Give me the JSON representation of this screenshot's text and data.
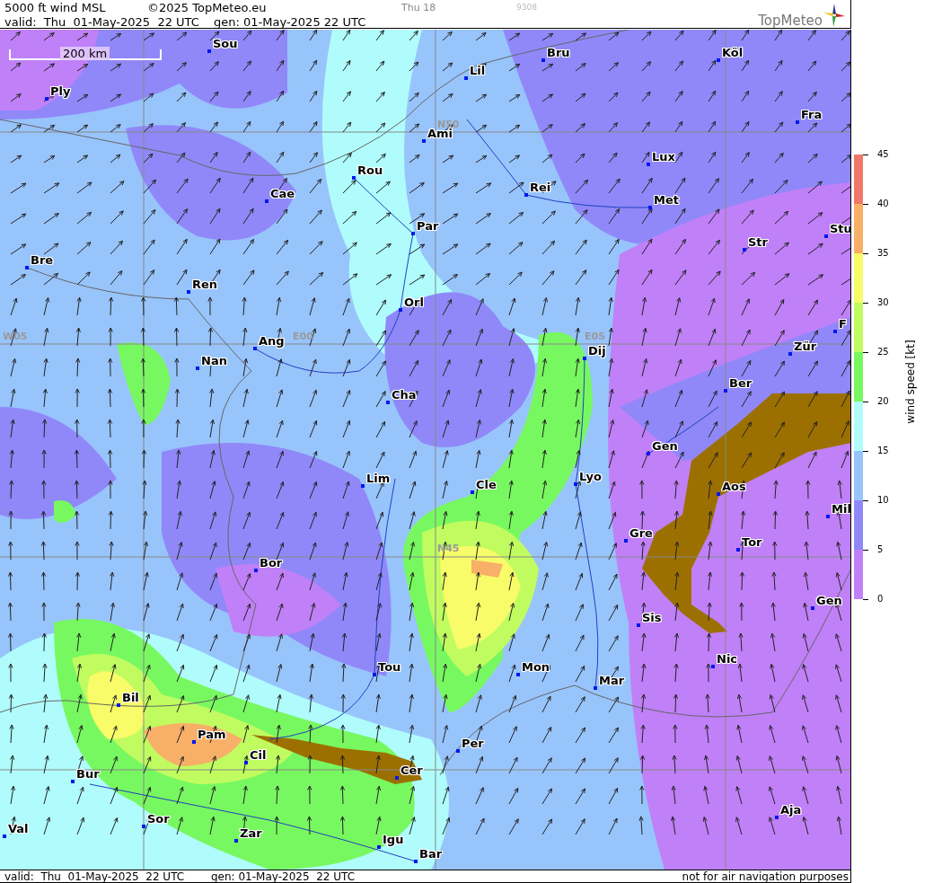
{
  "header": {
    "title": "5000 ft wind MSL",
    "copyright": "©2025 TopMeteo.eu",
    "run_label": "Thu 18",
    "code": "9308",
    "valid": "valid:  Thu  01-May-2025  22 UTC",
    "generated": "gen: 01-May-2025 22 UTC",
    "logo": "TopMeteo"
  },
  "map": {
    "scale_label": "200 km",
    "grid_labels": [
      "N50",
      "W05",
      "E00",
      "E05",
      "N45"
    ],
    "cities": [
      "Sou",
      "Bru",
      "Köl",
      "Ply",
      "Lil",
      "Fra",
      "Ami",
      "Lux",
      "Rou",
      "Rei",
      "Cae",
      "Met",
      "Par",
      "Stu",
      "Str",
      "Bre",
      "Ren",
      "Orl",
      "F",
      "Ang",
      "Dij",
      "Zür",
      "Nan",
      "Ber",
      "Cha",
      "Gen",
      "Lim",
      "Cle",
      "Lyo",
      "Aos",
      "Mil",
      "Gre",
      "Tor",
      "Bor",
      "Gen",
      "Sis",
      "Nic",
      "Tou",
      "Mon",
      "Mar",
      "Bil",
      "Pam",
      "Per",
      "Cil",
      "Cer",
      "Bur",
      "Aja",
      "Sor",
      "Val",
      "Zar",
      "Igu",
      "Bar"
    ]
  },
  "legend": {
    "title": "wind speed [kt]",
    "ticks": [
      "45",
      "40",
      "35",
      "30",
      "25",
      "20",
      "15",
      "10",
      "5",
      "0"
    ],
    "bins": [
      {
        "color": "#f07868"
      },
      {
        "color": "#f8b068"
      },
      {
        "color": "#f8fc68"
      },
      {
        "color": "#c0fc60"
      },
      {
        "color": "#78f860"
      },
      {
        "color": "#b0fcfc"
      },
      {
        "color": "#98c4fc"
      },
      {
        "color": "#9088f8"
      },
      {
        "color": "#c080f8"
      }
    ]
  },
  "footer": {
    "valid": "valid:  Thu  01-May-2025  22 UTC",
    "generated": "gen: 01-May-2025  22 UTC",
    "note": "not for air navigation purposes"
  }
}
